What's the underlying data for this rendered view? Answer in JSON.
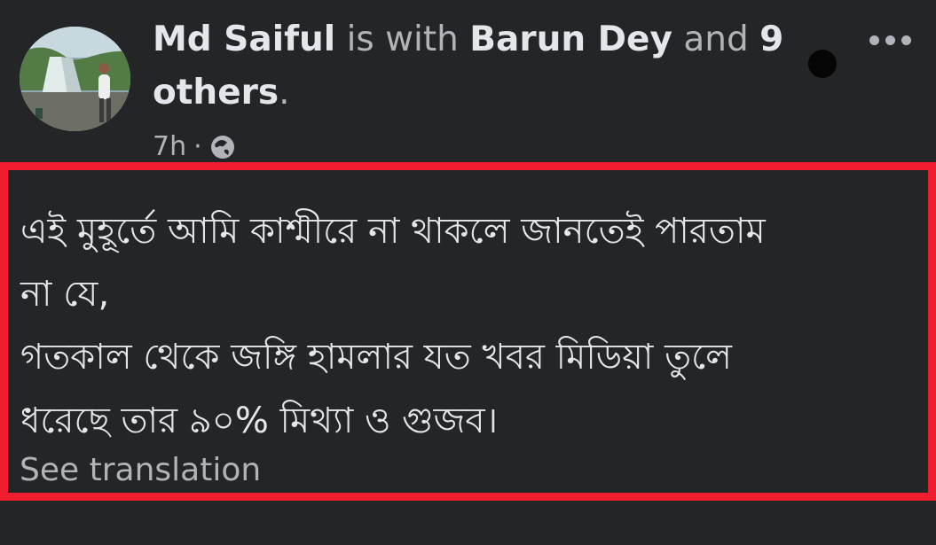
{
  "post": {
    "author": "Md Saiful",
    "with_text": "is with",
    "tagged_name": "Barun Dey",
    "and_text": "and",
    "others_count": "9",
    "others_text": "others",
    "period": ".",
    "timestamp": "7h",
    "separator": "·",
    "privacy_icon": "globe-icon",
    "more_icon": "more-options-icon",
    "body_lines": [
      "এই মুহূর্তে আমি কাশ্মীরে না থাকলে জানতেই পারতাম",
      "না যে,",
      "গতকাল থেকে জঙ্গি হামলার যত খবর মিডিয়া তুলে",
      "ধরেছে তার ৯০% মিথ্যা ও গুজব।"
    ],
    "see_translation": "See translation"
  },
  "colors": {
    "background": "#242526",
    "primary_text": "#e4e6eb",
    "secondary_text": "#b0b3b8",
    "highlight_border": "#ef1d2f"
  }
}
